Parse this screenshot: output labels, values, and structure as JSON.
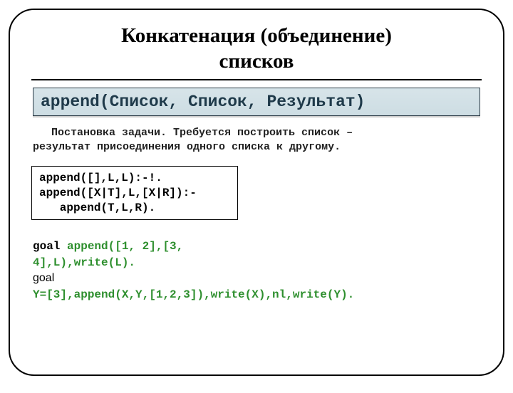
{
  "title_line1": "Конкатенация (объединение)",
  "title_line2": "списков",
  "signature": "append(Список, Список, Результат)",
  "task_line1": "Постановка задачи. Требуется построить список –",
  "task_line2": "результат присоединения одного списка к другому.",
  "code_line1": "append([],L,L):-!.",
  "code_line2": "append([X|T],L,[X|R]):-",
  "code_line3": "   append(T,L,R).",
  "goal1_kw": "goal ",
  "goal1_body_l1": "append([1, 2],[3,",
  "goal1_body_l2": "4],L),write(L).",
  "goal2_kw": "goal",
  "goal2_body": "Y=[3],append(X,Y,[1,2,3]),write(X),nl,write(Y)."
}
